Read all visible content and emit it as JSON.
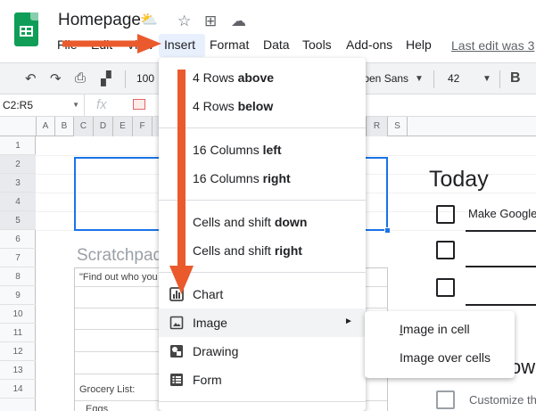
{
  "document": {
    "title": "Homepage",
    "title_emoji": "⛅",
    "star_icon": "☆",
    "folder_icon": "⊞",
    "cloud_icon": "☁"
  },
  "menubar": {
    "file": "File",
    "edit": "Edit",
    "view": "View",
    "insert": "Insert",
    "format": "Format",
    "data": "Data",
    "tools": "Tools",
    "addons": "Add-ons",
    "help": "Help",
    "last_edit": "Last edit was 3"
  },
  "toolbar": {
    "zoom": "100",
    "font": "Open Sans",
    "font_size": "42",
    "bold": "B"
  },
  "formula_bar": {
    "name_box": "C2:R5",
    "fx": "fx"
  },
  "columns": [
    "A",
    "B",
    "C",
    "D",
    "E",
    "F",
    "R",
    "S"
  ],
  "rows": [
    "1",
    "2",
    "3",
    "4",
    "5",
    "6",
    "7",
    "8",
    "9",
    "10",
    "11",
    "12",
    "13",
    "14"
  ],
  "sheet": {
    "scratchpad_title": "Scratchpad",
    "scratch_quote": "\"Find out who you",
    "grocery_list": "Grocery List:",
    "grocery_item": "Eggs",
    "today_title": "Today",
    "todo_1": "Make Google",
    "todo_customize": "Customize th",
    "row_fragment": "ow"
  },
  "insert_menu": {
    "rows_above_prefix": "4 Rows ",
    "rows_above_bold": "above",
    "rows_below_prefix": "4 Rows ",
    "rows_below_bold": "below",
    "cols_left_prefix": "16 Columns ",
    "cols_left_bold": "left",
    "cols_right_prefix": "16 Columns ",
    "cols_right_bold": "right",
    "shift_down_prefix": "Cells and shift ",
    "shift_down_bold": "down",
    "shift_right_prefix": "Cells and shift ",
    "shift_right_bold": "right",
    "chart": "Chart",
    "image": "Image",
    "drawing": "Drawing",
    "form": "Form"
  },
  "image_submenu": {
    "in_cell_mnemonic": "I",
    "in_cell_rest": "mage in cell",
    "over_cells_first": "Ima",
    "over_cells_mnemonic": "g",
    "over_cells_rest": "e over cells"
  },
  "colors": {
    "accent_blue": "#1a73e8",
    "sheets_green": "#0f9d58",
    "annotation_arrow": "#ea5a2d",
    "hover": "#f1f3f4"
  }
}
